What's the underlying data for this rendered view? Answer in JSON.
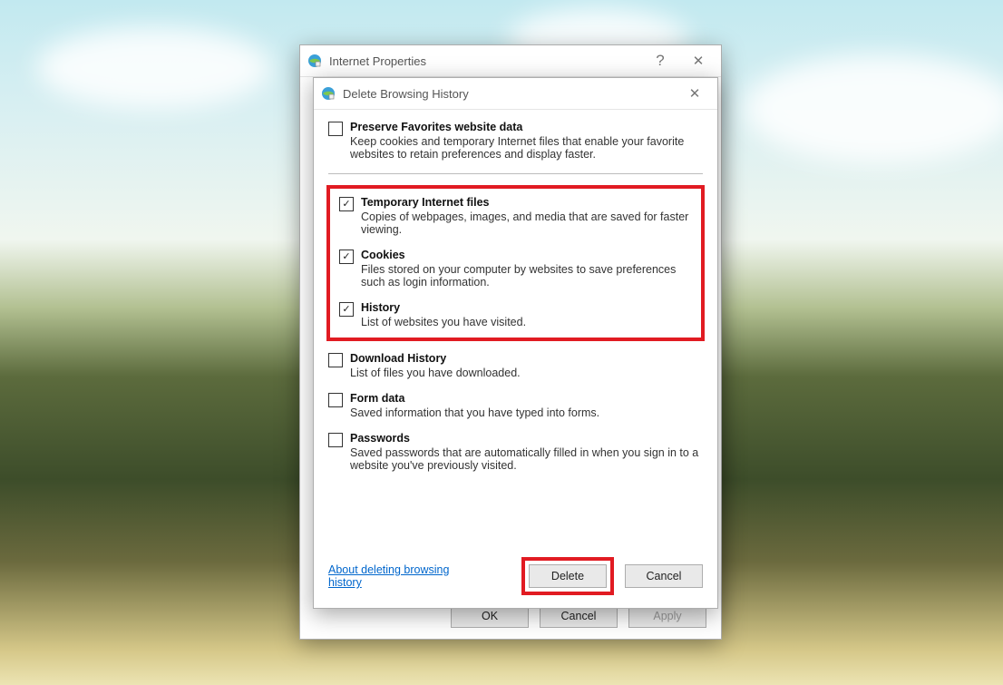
{
  "parent": {
    "title": "Internet Properties",
    "buttons": {
      "ok": "OK",
      "cancel": "Cancel",
      "apply": "Apply"
    }
  },
  "dialog": {
    "title": "Delete Browsing History",
    "preserve": {
      "label": "Preserve Favorites website data",
      "desc": "Keep cookies and temporary Internet files that enable your favorite websites to retain preferences and display faster.",
      "checked": false
    },
    "items": [
      {
        "key": "temp",
        "label": "Temporary Internet files",
        "desc": "Copies of webpages, images, and media that are saved for faster viewing.",
        "checked": true,
        "highlighted": true
      },
      {
        "key": "cookies",
        "label": "Cookies",
        "desc": "Files stored on your computer by websites to save preferences such as login information.",
        "checked": true,
        "highlighted": true
      },
      {
        "key": "history",
        "label": "History",
        "desc": "List of websites you have visited.",
        "checked": true,
        "highlighted": true
      },
      {
        "key": "download",
        "label": "Download History",
        "desc": "List of files you have downloaded.",
        "checked": false,
        "highlighted": false
      },
      {
        "key": "form",
        "label": "Form data",
        "desc": "Saved information that you have typed into forms.",
        "checked": false,
        "highlighted": false
      },
      {
        "key": "passwords",
        "label": "Passwords",
        "desc": "Saved passwords that are automatically filled in when you sign in to a website you've previously visited.",
        "checked": false,
        "highlighted": false
      }
    ],
    "link": "About deleting browsing history",
    "delete": "Delete",
    "cancel": "Cancel"
  }
}
